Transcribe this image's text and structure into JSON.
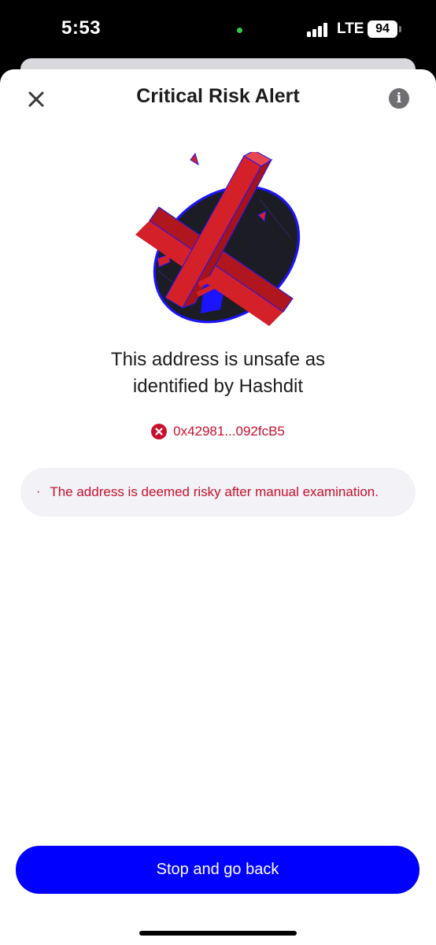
{
  "status_bar": {
    "time": "5:53",
    "network": "LTE",
    "battery": "94"
  },
  "header": {
    "title": "Critical Risk Alert",
    "close_icon": "close-icon",
    "info_icon": "info-icon"
  },
  "illustration": {
    "icon": "risk-x-illustration",
    "colors": {
      "cross": "#d42028",
      "disc": "#1c1c24",
      "accent": "#1a14ff"
    }
  },
  "message": {
    "line1": "This address is unsafe as",
    "line2": "identified by Hashdit"
  },
  "address": {
    "icon": "error-circle-icon",
    "value": "0x42981...092fcB5"
  },
  "reasons": [
    {
      "bullet": "·",
      "text": "The address is deemed risky after manual examination."
    }
  ],
  "actions": {
    "primary_label": "Stop and go back"
  },
  "colors": {
    "primary": "#0000ff",
    "danger": "#c8102e",
    "reason_bg": "#f2f2f7"
  }
}
